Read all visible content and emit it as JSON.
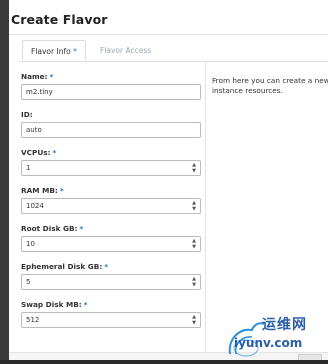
{
  "modal": {
    "title": "Create Flavor"
  },
  "tabs": [
    {
      "label": "Flavor Info",
      "required_marker": "*",
      "active": true
    },
    {
      "label": "Flavor Access",
      "active": false
    }
  ],
  "fields": [
    {
      "label": "Name:",
      "required": "*",
      "value": "m2.tiny",
      "spinner": false
    },
    {
      "label": "ID:",
      "required": "",
      "value": "auto",
      "spinner": false
    },
    {
      "label": "VCPUs:",
      "required": "*",
      "value": "1",
      "spinner": true
    },
    {
      "label": "RAM MB:",
      "required": "*",
      "value": "1024",
      "spinner": true
    },
    {
      "label": "Root Disk GB:",
      "required": "*",
      "value": "10",
      "spinner": true
    },
    {
      "label": "Ephemeral Disk GB:",
      "required": "*",
      "value": "5",
      "spinner": true
    },
    {
      "label": "Swap Disk MB:",
      "required": "*",
      "value": "512",
      "spinner": true
    }
  ],
  "help": {
    "line1": "From here you can create a new flavor",
    "line2": "instance resources."
  },
  "watermark": {
    "chinese": "运维网",
    "url": "iyunv.com"
  },
  "colors": {
    "required_star": "#1a73c8",
    "inactive_tab": "#9aa5b1",
    "watermark": "#2a5ea8"
  },
  "icons": {
    "spinner_up": "▲",
    "spinner_down": "▼"
  }
}
